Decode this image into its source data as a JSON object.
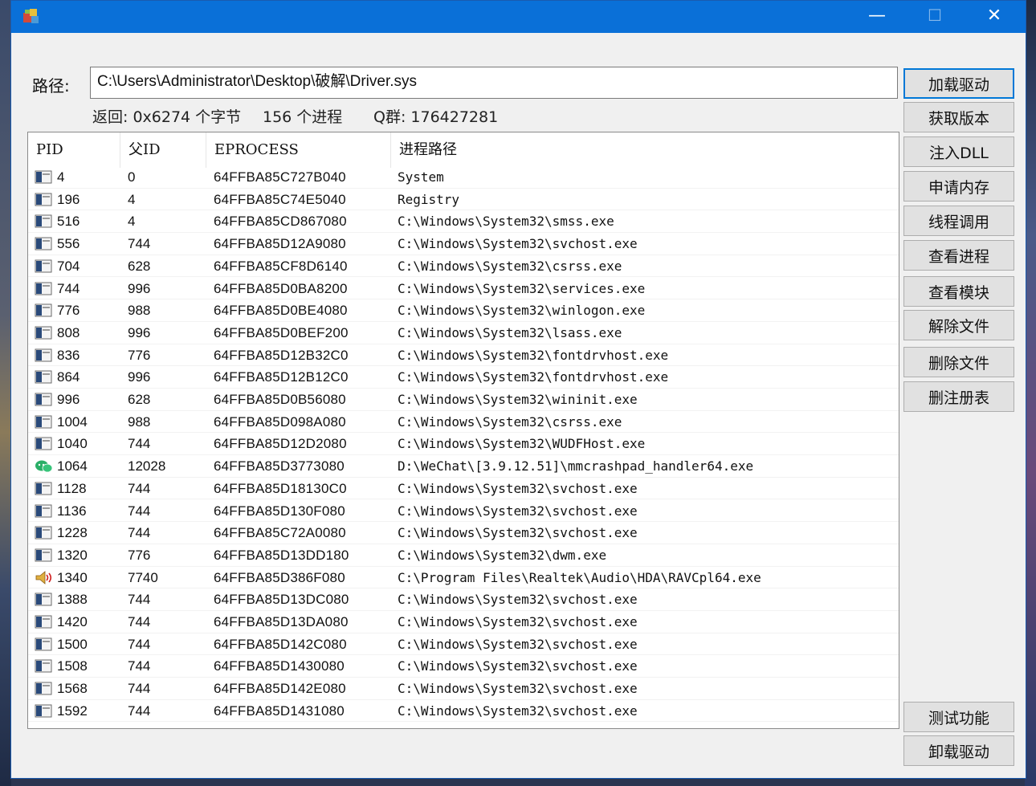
{
  "window": {
    "minimize_glyph": "—",
    "maximize_glyph": "☐",
    "close_glyph": "✕"
  },
  "path": {
    "label": "路径:",
    "value": "C:\\Users\\Administrator\\Desktop\\破解\\Driver.sys"
  },
  "status": {
    "returned": "返回: 0x6274 个字节",
    "processes": "156 个进程",
    "qq_group": "Q群: 176427281"
  },
  "columns": [
    "PID",
    "父ID",
    "EPROCESS",
    "进程路径"
  ],
  "rows": [
    {
      "icon": "app",
      "pid": "4",
      "ppid": "0",
      "eprocess": "64FFBA85C727B040",
      "path": "System"
    },
    {
      "icon": "app",
      "pid": "196",
      "ppid": "4",
      "eprocess": "64FFBA85C74E5040",
      "path": "Registry"
    },
    {
      "icon": "app",
      "pid": "516",
      "ppid": "4",
      "eprocess": "64FFBA85CD867080",
      "path": "C:\\Windows\\System32\\smss.exe"
    },
    {
      "icon": "app",
      "pid": "556",
      "ppid": "744",
      "eprocess": "64FFBA85D12A9080",
      "path": "C:\\Windows\\System32\\svchost.exe"
    },
    {
      "icon": "app",
      "pid": "704",
      "ppid": "628",
      "eprocess": "64FFBA85CF8D6140",
      "path": "C:\\Windows\\System32\\csrss.exe"
    },
    {
      "icon": "app",
      "pid": "744",
      "ppid": "996",
      "eprocess": "64FFBA85D0BA8200",
      "path": "C:\\Windows\\System32\\services.exe"
    },
    {
      "icon": "app",
      "pid": "776",
      "ppid": "988",
      "eprocess": "64FFBA85D0BE4080",
      "path": "C:\\Windows\\System32\\winlogon.exe"
    },
    {
      "icon": "app",
      "pid": "808",
      "ppid": "996",
      "eprocess": "64FFBA85D0BEF200",
      "path": "C:\\Windows\\System32\\lsass.exe"
    },
    {
      "icon": "app",
      "pid": "836",
      "ppid": "776",
      "eprocess": "64FFBA85D12B32C0",
      "path": "C:\\Windows\\System32\\fontdrvhost.exe"
    },
    {
      "icon": "app",
      "pid": "864",
      "ppid": "996",
      "eprocess": "64FFBA85D12B12C0",
      "path": "C:\\Windows\\System32\\fontdrvhost.exe"
    },
    {
      "icon": "app",
      "pid": "996",
      "ppid": "628",
      "eprocess": "64FFBA85D0B56080",
      "path": "C:\\Windows\\System32\\wininit.exe"
    },
    {
      "icon": "app",
      "pid": "1004",
      "ppid": "988",
      "eprocess": "64FFBA85D098A080",
      "path": "C:\\Windows\\System32\\csrss.exe"
    },
    {
      "icon": "app",
      "pid": "1040",
      "ppid": "744",
      "eprocess": "64FFBA85D12D2080",
      "path": "C:\\Windows\\System32\\WUDFHost.exe"
    },
    {
      "icon": "wechat",
      "pid": "1064",
      "ppid": "12028",
      "eprocess": "64FFBA85D3773080",
      "path": "D:\\WeChat\\[3.9.12.51]\\mmcrashpad_handler64.exe"
    },
    {
      "icon": "app",
      "pid": "1128",
      "ppid": "744",
      "eprocess": "64FFBA85D18130C0",
      "path": "C:\\Windows\\System32\\svchost.exe"
    },
    {
      "icon": "app",
      "pid": "1136",
      "ppid": "744",
      "eprocess": "64FFBA85D130F080",
      "path": "C:\\Windows\\System32\\svchost.exe"
    },
    {
      "icon": "app",
      "pid": "1228",
      "ppid": "744",
      "eprocess": "64FFBA85C72A0080",
      "path": "C:\\Windows\\System32\\svchost.exe"
    },
    {
      "icon": "app",
      "pid": "1320",
      "ppid": "776",
      "eprocess": "64FFBA85D13DD180",
      "path": "C:\\Windows\\System32\\dwm.exe"
    },
    {
      "icon": "speaker",
      "pid": "1340",
      "ppid": "7740",
      "eprocess": "64FFBA85D386F080",
      "path": "C:\\Program Files\\Realtek\\Audio\\HDA\\RAVCpl64.exe"
    },
    {
      "icon": "app",
      "pid": "1388",
      "ppid": "744",
      "eprocess": "64FFBA85D13DC080",
      "path": "C:\\Windows\\System32\\svchost.exe"
    },
    {
      "icon": "app",
      "pid": "1420",
      "ppid": "744",
      "eprocess": "64FFBA85D13DA080",
      "path": "C:\\Windows\\System32\\svchost.exe"
    },
    {
      "icon": "app",
      "pid": "1500",
      "ppid": "744",
      "eprocess": "64FFBA85D142C080",
      "path": "C:\\Windows\\System32\\svchost.exe"
    },
    {
      "icon": "app",
      "pid": "1508",
      "ppid": "744",
      "eprocess": "64FFBA85D1430080",
      "path": "C:\\Windows\\System32\\svchost.exe"
    },
    {
      "icon": "app",
      "pid": "1568",
      "ppid": "744",
      "eprocess": "64FFBA85D142E080",
      "path": "C:\\Windows\\System32\\svchost.exe"
    },
    {
      "icon": "app",
      "pid": "1592",
      "ppid": "744",
      "eprocess": "64FFBA85D1431080",
      "path": "C:\\Windows\\System32\\svchost.exe"
    }
  ],
  "buttons": {
    "load_driver": "加载驱动",
    "get_version": "获取版本",
    "inject_dll": "注入DLL",
    "alloc_memory": "申请内存",
    "thread_call": "线程调用",
    "view_process": "查看进程",
    "view_module": "查看模块",
    "unlock_file": "解除文件",
    "delete_file": "删除文件",
    "delete_registry": "删注册表",
    "test_function": "测试功能",
    "unload_driver": "卸载驱动"
  }
}
